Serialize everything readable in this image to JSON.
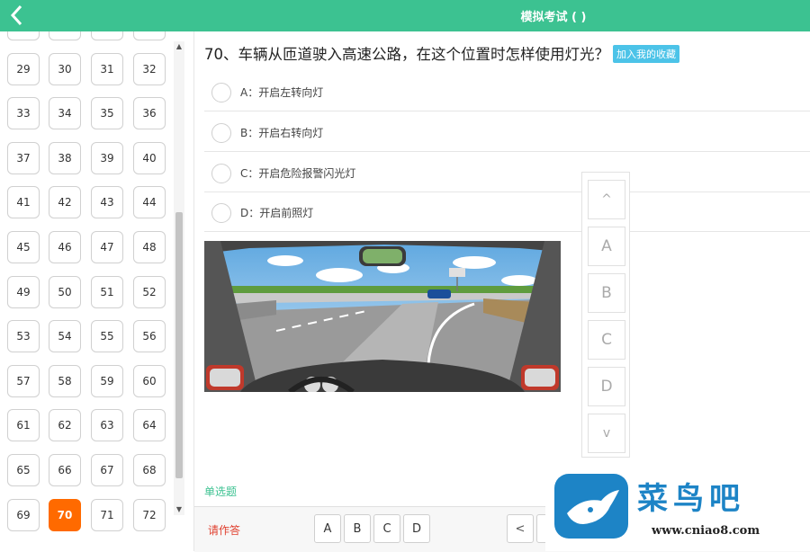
{
  "header": {
    "title": "模拟考试 ( )"
  },
  "grid": {
    "numbers": [
      "",
      "",
      "",
      "",
      "29",
      "30",
      "31",
      "32",
      "33",
      "34",
      "35",
      "36",
      "37",
      "38",
      "39",
      "40",
      "41",
      "42",
      "43",
      "44",
      "45",
      "46",
      "47",
      "48",
      "49",
      "50",
      "51",
      "52",
      "53",
      "54",
      "55",
      "56",
      "57",
      "58",
      "59",
      "60",
      "61",
      "62",
      "63",
      "64",
      "65",
      "66",
      "67",
      "68",
      "69",
      "70",
      "71",
      "72"
    ],
    "current": "70"
  },
  "question": {
    "text": "70、车辆从匝道驶入高速公路，在这个位置时怎样使用灯光？",
    "favorite_label": "加入我的收藏",
    "options": [
      {
        "text": "A：开启左转向灯"
      },
      {
        "text": "B：开启右转向灯"
      },
      {
        "text": "C：开启危险报警闪光灯"
      },
      {
        "text": "D：开启前照灯"
      }
    ],
    "type_label": "单选题"
  },
  "answer_bar": {
    "prompt": "请作答",
    "choices": [
      "A",
      "B",
      "C",
      "D"
    ],
    "prev_label": "<"
  },
  "side_panel": {
    "up_label": "^",
    "letters": [
      "A",
      "B",
      "C",
      "D"
    ],
    "down_label": "v"
  },
  "watermark": {
    "name": "菜鸟吧",
    "url": "www.cniao8.com"
  },
  "colors": {
    "header_bg": "#3cc291",
    "current_number": "#ff6a00",
    "favorite_bg": "#4cc3e8",
    "prompt": "#e0402f"
  }
}
